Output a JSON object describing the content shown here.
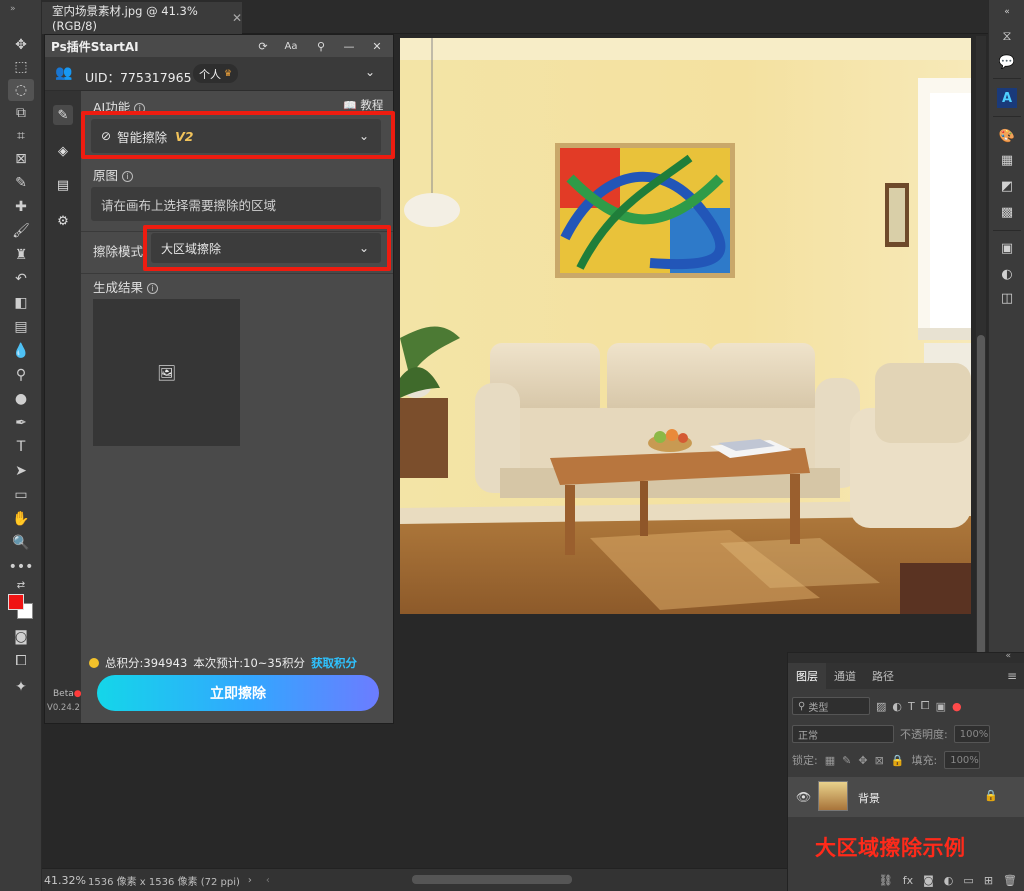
{
  "document": {
    "tab_title": "室内场景素材.jpg @ 41.3%(RGB/8)",
    "zoom": "41.32%",
    "size_info": "1536 像素 x 1536 像素 (72 ppi)"
  },
  "plugin": {
    "title": "Ps插件StartAI",
    "uid": "UID：775317965",
    "account_type": "个人",
    "ai_function_label": "AI功能",
    "tutorial_label": "教程",
    "function_value": "智能擦除",
    "function_version": "V2",
    "original_label": "原图",
    "original_placeholder": "请在画布上选择需要擦除的区域",
    "erase_mode_label": "擦除模式",
    "erase_mode_value": "大区域擦除",
    "result_label": "生成结果",
    "total_points": "总积分:394943",
    "estimate": "本次预计:10~35积分",
    "get_points": "获取积分",
    "go_button": "立即擦除",
    "beta": "Beta",
    "version": "V0.24.2"
  },
  "layers": {
    "tabs": [
      "图层",
      "通道",
      "路径"
    ],
    "kind_filter": "类型",
    "blend_mode": "正常",
    "opacity_label": "不透明度:",
    "opacity_value": "100%",
    "lock_label": "锁定:",
    "fill_label": "填充:",
    "fill_value": "100%",
    "layer_name": "背景"
  },
  "caption": "大区域擦除示例",
  "colors": {
    "highlight": "#ee1c10",
    "button_start": "#14d6e9",
    "button_end": "#6c7cff",
    "link": "#2ec3ff",
    "foreground_swatch": "#f01414"
  }
}
